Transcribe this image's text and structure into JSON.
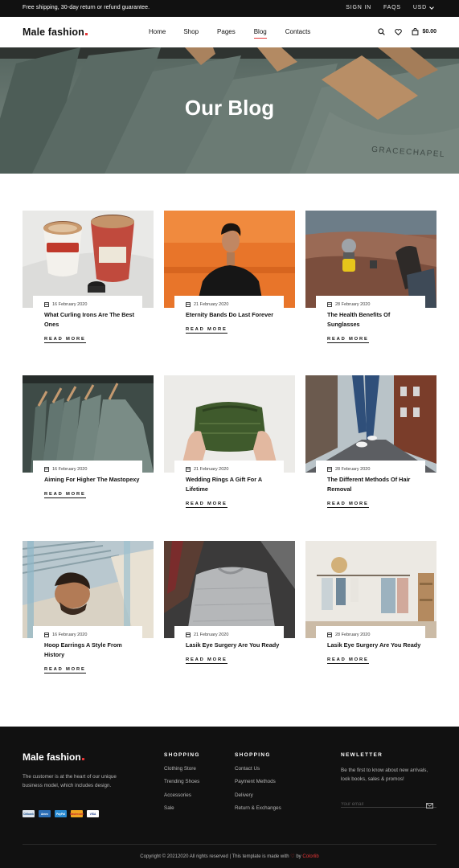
{
  "topbar": {
    "promo": "Free shipping, 30-day return or refund guarantee.",
    "sign_in": "SIGN IN",
    "faqs": "FAQS",
    "currency": "USD"
  },
  "header": {
    "logo": "Male fashion",
    "nav": [
      "Home",
      "Shop",
      "Pages",
      "Blog",
      "Contacts"
    ],
    "active_nav": "Blog",
    "cart_total": "$0.00"
  },
  "hero": {
    "title": "Our Blog",
    "brand_print": "GRACECHAPEL"
  },
  "blog": {
    "read_more": "READ MORE",
    "posts": [
      {
        "date": "16 February 2020",
        "title": "What Curling Irons Are The Best Ones",
        "image": "coffee-cups"
      },
      {
        "date": "21 February 2020",
        "title": "Eternity Bands Do Last Forever",
        "image": "man-orange-wall"
      },
      {
        "date": "28 February 2020",
        "title": "The Health Benefits Of Sunglasses",
        "image": "camping-kettle"
      },
      {
        "date": "16 February 2020",
        "title": "Aiming For Higher The Mastopexy",
        "image": "shirts-on-hangers"
      },
      {
        "date": "21 February 2020",
        "title": "Wedding Rings A Gift For A Lifetime",
        "image": "green-sweater"
      },
      {
        "date": "28 February 2020",
        "title": "The Different Methods Of Hair Removal",
        "image": "street-walk"
      },
      {
        "date": "16 February 2020",
        "title": "Hoop Earrings A Style From History",
        "image": "man-lying"
      },
      {
        "date": "21 February 2020",
        "title": "Lasik Eye Surgery Are You Ready",
        "image": "grey-shirt"
      },
      {
        "date": "28 February 2020",
        "title": "Lasik Eye Surgery Are You Ready",
        "image": "clothing-store"
      }
    ]
  },
  "footer": {
    "logo": "Male fashion",
    "description": "The customer is at the heart of our unique business model, which includes design.",
    "payments": [
      "Citibank",
      "Amex",
      "PayPal",
      "Mastercard",
      "VISA"
    ],
    "col1": {
      "heading": "SHOPPING",
      "links": [
        "Clothing Store",
        "Trending Shoes",
        "Accessories",
        "Sale"
      ]
    },
    "col2": {
      "heading": "SHOPPING",
      "links": [
        "Contact Us",
        "Payment Methods",
        "Delivery",
        "Return & Exchanges"
      ]
    },
    "newsletter": {
      "heading": "NEWLETTER",
      "text": "Be the first to know about new arrivals, look books, sales & promos!",
      "placeholder": "Your email"
    },
    "copyright_pre": "Copyright © 20212020 All rights reserved | This template is made with",
    "copyright_by": "by",
    "copyright_brand": "Colorlib"
  },
  "colors": {
    "accent": "#e53637",
    "dark": "#111111"
  }
}
